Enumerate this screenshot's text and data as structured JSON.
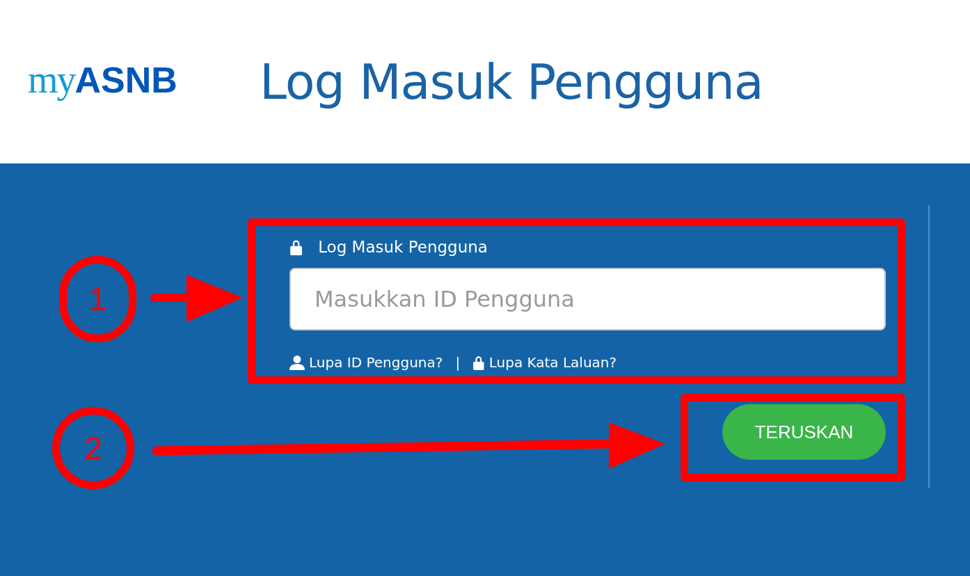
{
  "logo": {
    "prefix": "my",
    "name": "ASNB"
  },
  "title": "Log Masuk Pengguna",
  "login": {
    "label": "Log Masuk Pengguna",
    "input": {
      "placeholder": "Masukkan ID Pengguna"
    },
    "links": [
      {
        "kind": "user",
        "text": "Lupa ID Pengguna?"
      },
      {
        "kind": "lock",
        "text": "Lupa Kata Laluan?"
      }
    ],
    "separator": "|",
    "button": "TERUSKAN"
  },
  "annotations": [
    {
      "number": "1"
    },
    {
      "number": "2"
    }
  ]
}
